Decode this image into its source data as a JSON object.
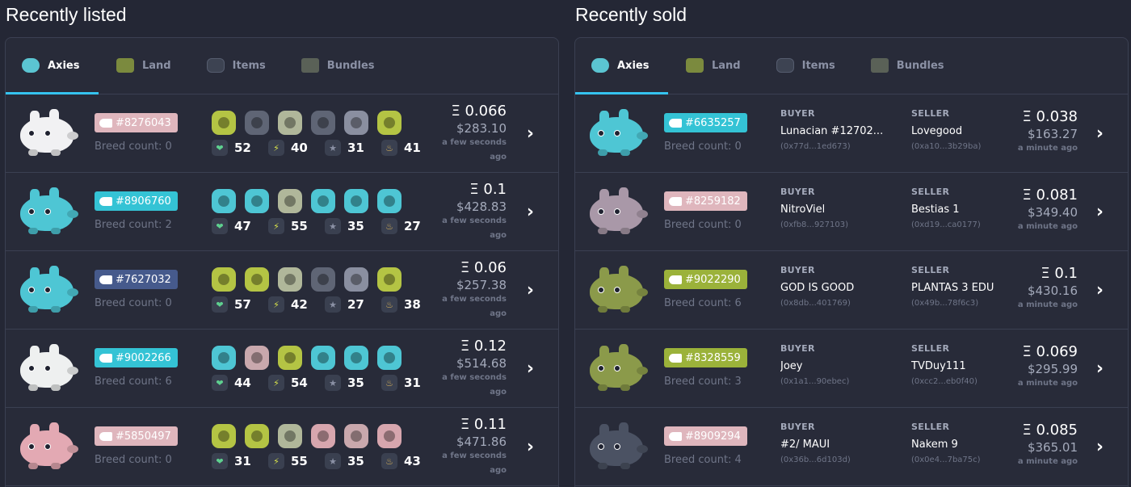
{
  "listed": {
    "title": "Recently listed",
    "tabs": [
      "Axies",
      "Land",
      "Items",
      "Bundles"
    ],
    "rows": [
      {
        "id": "#8276043",
        "badge_color": "#dfb6bd",
        "body_color": "#f1f1f3",
        "breed": "Breed count: 0",
        "parts": [
          "#b4c444",
          "#5f6575",
          "#b0b79a",
          "#5f6575",
          "#8a8fa0",
          "#b4c444"
        ],
        "stats": [
          "52",
          "40",
          "31",
          "41"
        ],
        "eth": "Ξ 0.066",
        "usd": "$283.10",
        "ago": "a few seconds ago"
      },
      {
        "id": "#8906760",
        "badge_color": "#34c3d5",
        "body_color": "#4ec6d4",
        "breed": "Breed count: 2",
        "parts": [
          "#4ec6d4",
          "#4ec6d4",
          "#b0b79a",
          "#4ec6d4",
          "#4ec6d4",
          "#4ec6d4"
        ],
        "stats": [
          "47",
          "55",
          "35",
          "27"
        ],
        "eth": "Ξ 0.1",
        "usd": "$428.83",
        "ago": "a few seconds ago"
      },
      {
        "id": "#7627032",
        "badge_color": "#465a8c",
        "body_color": "#4ec6d4",
        "breed": "Breed count: 0",
        "parts": [
          "#b4c444",
          "#b4c444",
          "#b0b79a",
          "#5f6575",
          "#8a8fa0",
          "#b4c444"
        ],
        "stats": [
          "57",
          "42",
          "27",
          "38"
        ],
        "eth": "Ξ 0.06",
        "usd": "$257.38",
        "ago": "a few seconds ago"
      },
      {
        "id": "#9002266",
        "badge_color": "#34c3d5",
        "body_color": "#eef0f0",
        "breed": "Breed count: 6",
        "parts": [
          "#4ec6d4",
          "#c9a8ad",
          "#b4c444",
          "#4ec6d4",
          "#4ec6d4",
          "#4ec6d4"
        ],
        "stats": [
          "44",
          "54",
          "35",
          "31"
        ],
        "eth": "Ξ 0.12",
        "usd": "$514.68",
        "ago": "a few seconds ago"
      },
      {
        "id": "#5850497",
        "badge_color": "#dfb6bd",
        "body_color": "#e3a9b3",
        "breed": "Breed count: 0",
        "parts": [
          "#b4c444",
          "#b4c444",
          "#b0b79a",
          "#d7a6ae",
          "#c9a8ad",
          "#d7a6ae"
        ],
        "stats": [
          "31",
          "55",
          "35",
          "43"
        ],
        "eth": "Ξ 0.11",
        "usd": "$471.86",
        "ago": "a few seconds ago"
      }
    ]
  },
  "sold": {
    "title": "Recently sold",
    "tabs": [
      "Axies",
      "Land",
      "Items",
      "Bundles"
    ],
    "buyer_label": "BUYER",
    "seller_label": "SELLER",
    "rows": [
      {
        "id": "#6635257",
        "badge_color": "#34c3d5",
        "body_color": "#4ec6d4",
        "breed": "Breed count: 0",
        "buyer": "Lunacian #12702...",
        "buyer_addr": "(0x77d...1ed673)",
        "seller": "Lovegood",
        "seller_addr": "(0xa10...3b29ba)",
        "eth": "Ξ 0.038",
        "usd": "$163.27",
        "ago": "a minute ago"
      },
      {
        "id": "#8259182",
        "badge_color": "#dfb6bd",
        "body_color": "#a998a8",
        "breed": "Breed count: 0",
        "buyer": "NitroViel",
        "buyer_addr": "(0xfb8...927103)",
        "seller": "Bestias 1",
        "seller_addr": "(0xd19...ca0177)",
        "eth": "Ξ 0.081",
        "usd": "$349.40",
        "ago": "a minute ago"
      },
      {
        "id": "#9022290",
        "badge_color": "#9bb23a",
        "body_color": "#8b9a4a",
        "breed": "Breed count: 6",
        "buyer": "GOD IS GOOD",
        "buyer_addr": "(0x8db...401769)",
        "seller": "PLANTAS 3 EDU",
        "seller_addr": "(0x49b...78f6c3)",
        "eth": "Ξ 0.1",
        "usd": "$430.16",
        "ago": "a minute ago"
      },
      {
        "id": "#8328559",
        "badge_color": "#9bb23a",
        "body_color": "#8b9a4a",
        "breed": "Breed count: 3",
        "buyer": "Joey",
        "buyer_addr": "(0x1a1...90ebec)",
        "seller": "TVDuy111",
        "seller_addr": "(0xcc2...eb0f40)",
        "eth": "Ξ 0.069",
        "usd": "$295.99",
        "ago": "a minute ago"
      },
      {
        "id": "#8909294",
        "badge_color": "#dfb6bd",
        "body_color": "#4b5263",
        "breed": "Breed count: 4",
        "buyer": "#2/ MAUI",
        "buyer_addr": "(0x36b...6d103d)",
        "seller": "Nakem 9",
        "seller_addr": "(0x0e4...7ba75c)",
        "eth": "Ξ 0.085",
        "usd": "$365.01",
        "ago": "a minute ago"
      }
    ]
  },
  "icons": {
    "tab_icons": [
      "axie-icon",
      "land-icon",
      "items-icon",
      "bundles-icon"
    ],
    "stat_icons": [
      "health-icon",
      "speed-icon",
      "skill-icon",
      "morale-icon"
    ],
    "chevron": "chevron-right-icon"
  },
  "glyphs": {
    "health": "❤",
    "speed": "⚡",
    "skill": "★",
    "morale": "♨",
    "chevron": "›"
  }
}
